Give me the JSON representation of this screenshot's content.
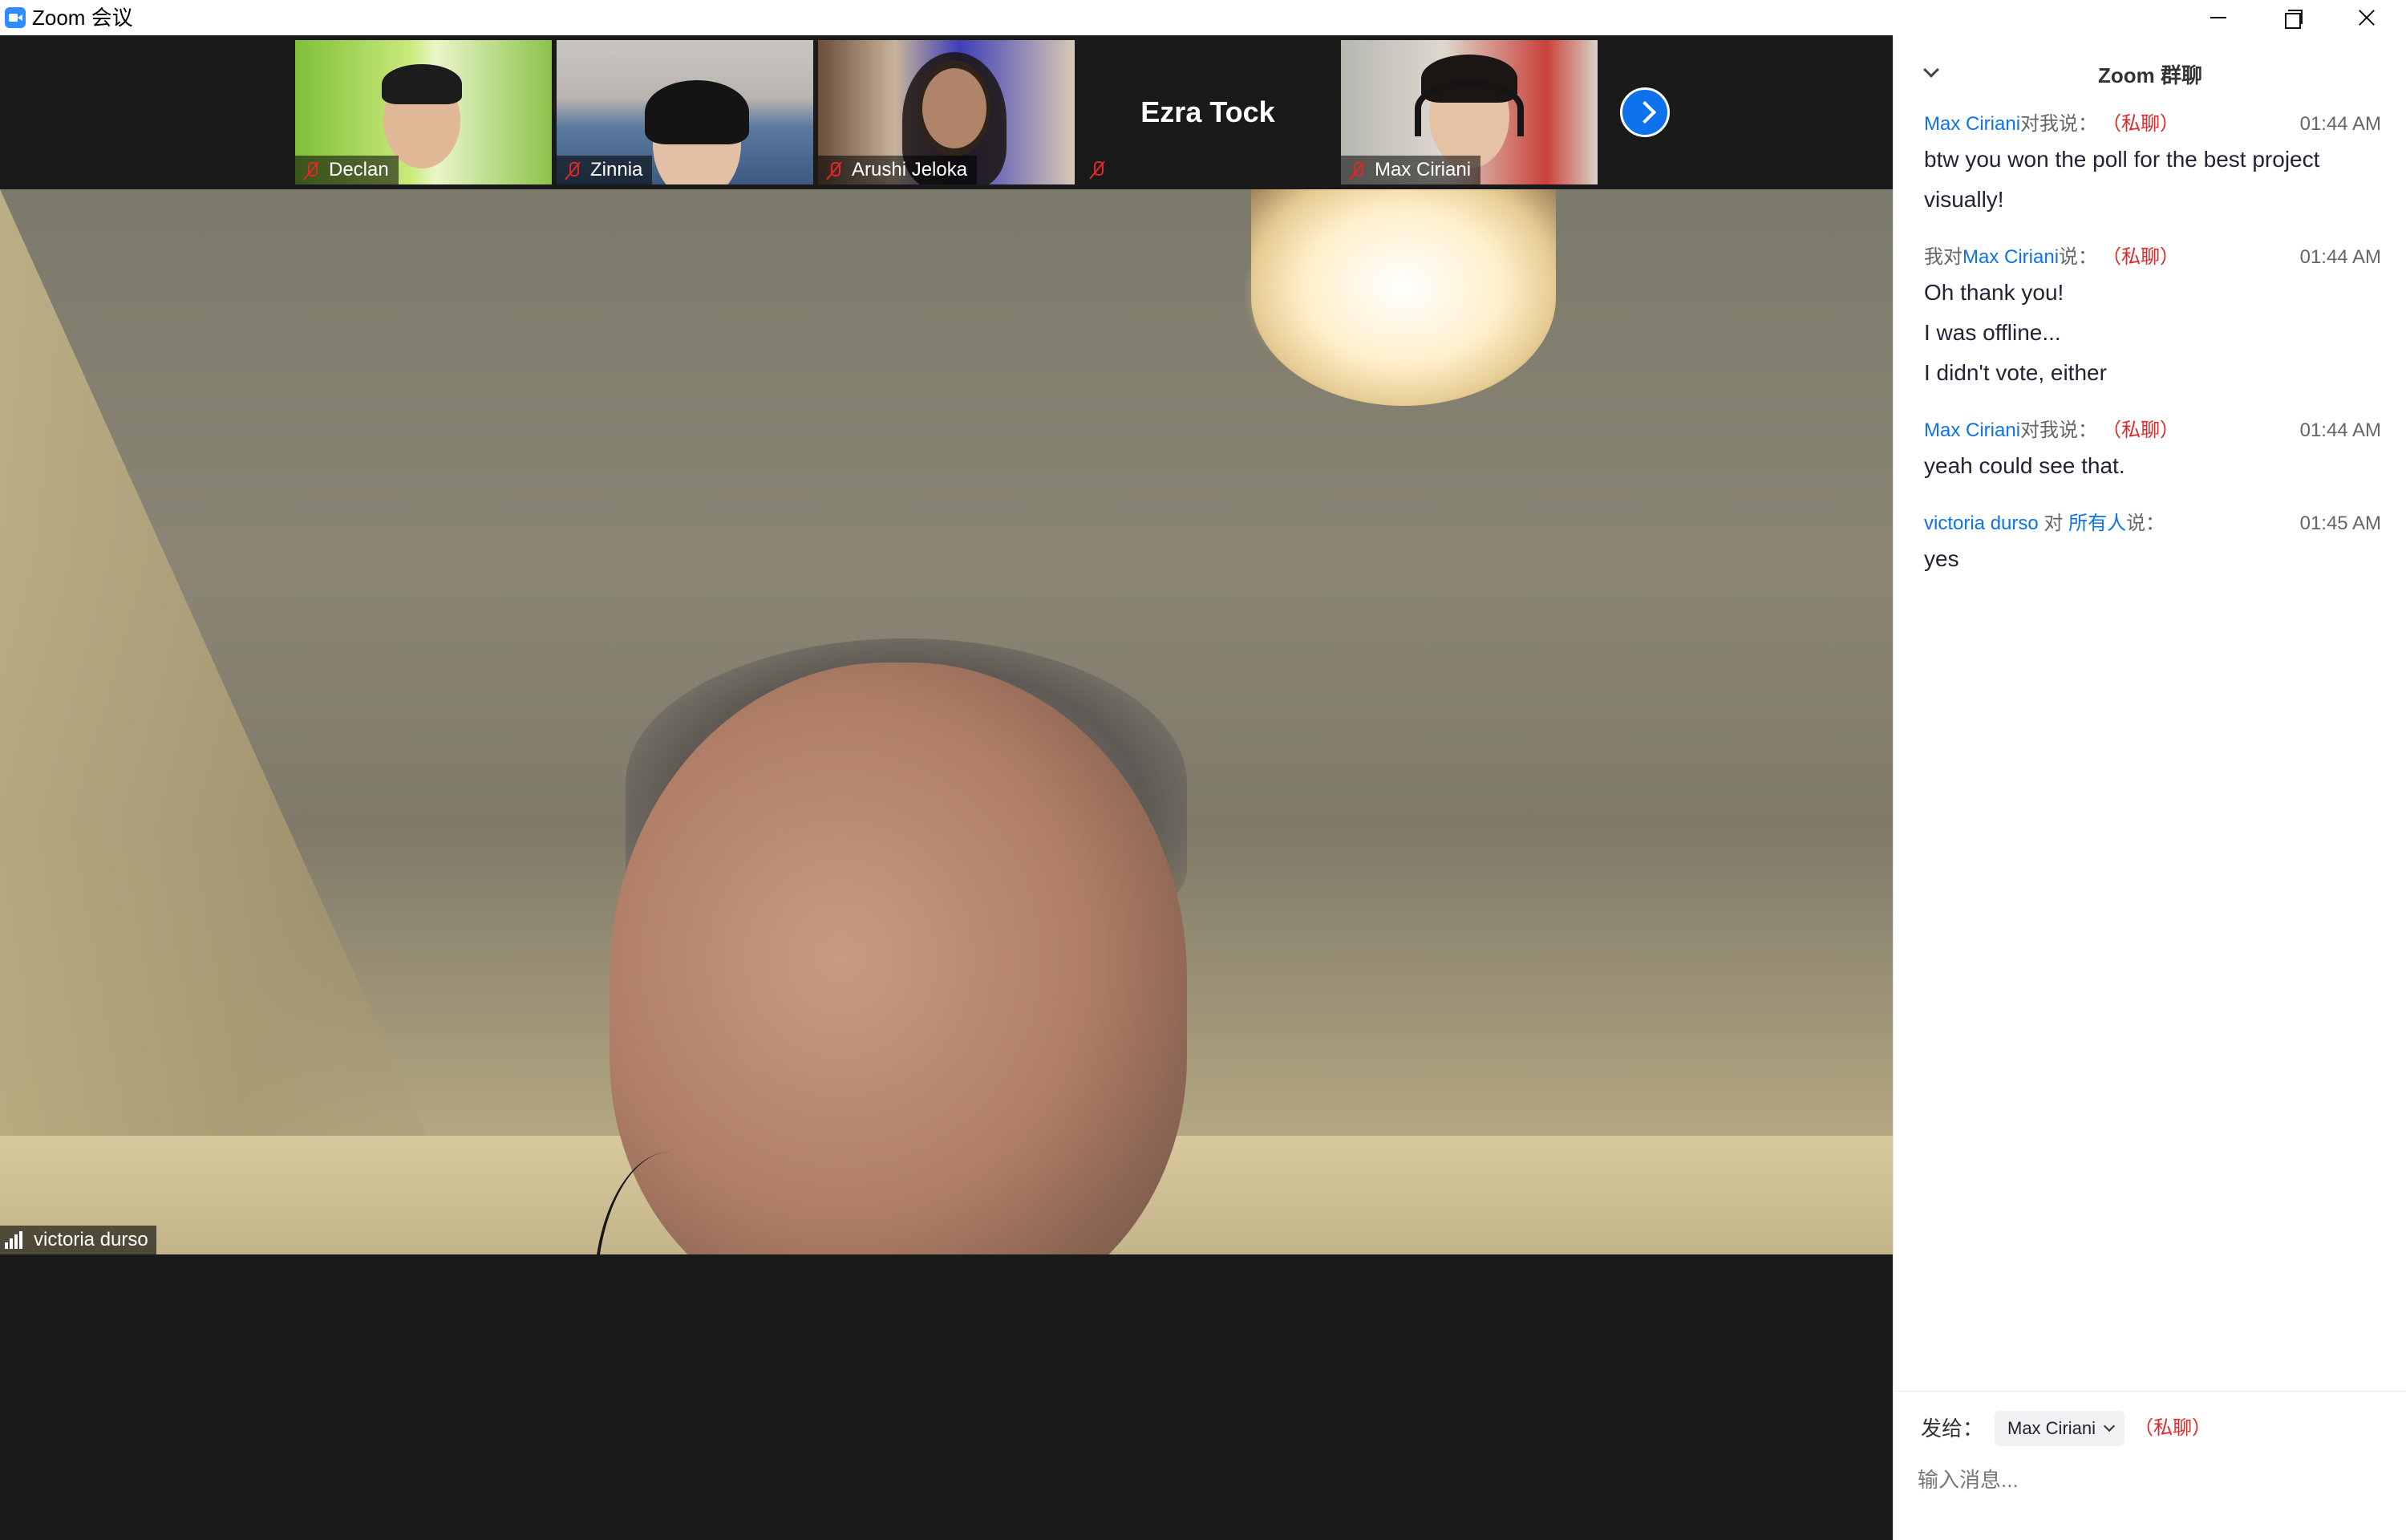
{
  "window": {
    "title": "Zoom 会议"
  },
  "thumbnails": [
    {
      "name": "Declan",
      "muted": true
    },
    {
      "name": "Zinnia",
      "muted": true
    },
    {
      "name": "Arushi Jeloka",
      "muted": true
    },
    {
      "name": "Ezra Tock",
      "muted": true,
      "video_off": true
    },
    {
      "name": "Max Ciriani",
      "muted": true
    }
  ],
  "main_video": {
    "speaker_name": "victoria durso"
  },
  "chat": {
    "title": "Zoom 群聊",
    "messages": [
      {
        "prefix": "",
        "sender": "Max Ciriani",
        "suffix": "对我说：",
        "private_tag": "（私聊）",
        "time": "01:44 AM",
        "lines": [
          "btw you won the poll for the best project",
          "visually!"
        ]
      },
      {
        "prefix": "我对",
        "sender": "Max Ciriani",
        "suffix": "说：",
        "private_tag": "（私聊）",
        "time": "01:44 AM",
        "lines": [
          "Oh thank you!",
          "I was offline...",
          "I didn't vote, either"
        ]
      },
      {
        "prefix": "",
        "sender": "Max Ciriani",
        "suffix": "对我说：",
        "private_tag": "（私聊）",
        "time": "01:44 AM",
        "lines": [
          "yeah could see that."
        ]
      },
      {
        "prefix": "",
        "sender": "victoria durso",
        "middle": " 对 ",
        "recipient": "所有人",
        "suffix": "说：",
        "time": "01:45 AM",
        "lines": [
          "yes"
        ]
      }
    ],
    "footer": {
      "send_to_label": "发给：",
      "recipient": "Max Ciriani",
      "private_tag": "（私聊）",
      "input_placeholder": "输入消息..."
    }
  },
  "colors": {
    "accent": "#0e72ed",
    "private": "#e02828",
    "video_background": "#1a1a1a"
  }
}
